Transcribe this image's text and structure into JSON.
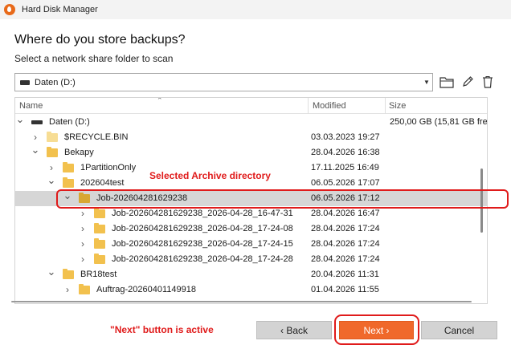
{
  "window": {
    "title": "Hard Disk Manager",
    "app_icon": "paragon-icon"
  },
  "heading": "Where do you store backups?",
  "subheading": "Select a network share folder to scan",
  "location": {
    "selected": "Daten (D:)"
  },
  "toolbar": {
    "icons": [
      "folder-icon",
      "pencil-icon",
      "trash-icon"
    ]
  },
  "table": {
    "columns": {
      "name": "Name",
      "modified": "Modified",
      "size": "Size"
    },
    "rows": [
      {
        "name": "Daten (D:)",
        "modified": "",
        "size": "250,00 GB (15,81 GB fre",
        "depth": 0,
        "expander": "expanded",
        "icon": "drive-icon"
      },
      {
        "name": "$RECYCLE.BIN",
        "modified": "03.03.2023 19:27",
        "size": "",
        "depth": 1,
        "expander": "collapsed",
        "icon": "folder-icon-pale"
      },
      {
        "name": "Bekapy",
        "modified": "28.04.2026 16:38",
        "size": "",
        "depth": 1,
        "expander": "expanded",
        "icon": "folder-icon"
      },
      {
        "name": "1PartitionOnly",
        "modified": "17.11.2025 16:49",
        "size": "",
        "depth": 2,
        "expander": "collapsed",
        "icon": "folder-icon"
      },
      {
        "name": "202604test",
        "modified": "06.05.2026 17:07",
        "size": "",
        "depth": 2,
        "expander": "expanded",
        "icon": "folder-icon"
      },
      {
        "name": "Job-202604281629238",
        "modified": "06.05.2026 17:12",
        "size": "",
        "depth": 3,
        "expander": "expanded",
        "icon": "folder-icon-dark",
        "selected": true
      },
      {
        "name": "Job-202604281629238_2026-04-28_16-47-31",
        "modified": "28.04.2026 16:47",
        "size": "",
        "depth": 4,
        "expander": "collapsed",
        "icon": "folder-icon"
      },
      {
        "name": "Job-202604281629238_2026-04-28_17-24-08",
        "modified": "28.04.2026 17:24",
        "size": "",
        "depth": 4,
        "expander": "collapsed",
        "icon": "folder-icon"
      },
      {
        "name": "Job-202604281629238_2026-04-28_17-24-15",
        "modified": "28.04.2026 17:24",
        "size": "",
        "depth": 4,
        "expander": "collapsed",
        "icon": "folder-icon"
      },
      {
        "name": "Job-202604281629238_2026-04-28_17-24-28",
        "modified": "28.04.2026 17:24",
        "size": "",
        "depth": 4,
        "expander": "collapsed",
        "icon": "folder-icon"
      },
      {
        "name": "BR18test",
        "modified": "20.04.2026 11:31",
        "size": "",
        "depth": 2,
        "expander": "expanded",
        "icon": "folder-icon"
      },
      {
        "name": "Auftrag-20260401149918",
        "modified": "01.04.2026 11:55",
        "size": "",
        "depth": 3,
        "expander": "collapsed",
        "icon": "folder-icon"
      }
    ]
  },
  "annotations": {
    "selected_label": "Selected Archive directory",
    "next_label": "\"Next\" button is active",
    "color": "#e01b1b"
  },
  "buttons": {
    "back": "‹ Back",
    "next": "Next ›",
    "cancel": "Cancel"
  },
  "colors": {
    "accent": "#f0692b",
    "selection": "#d6d6d6"
  }
}
